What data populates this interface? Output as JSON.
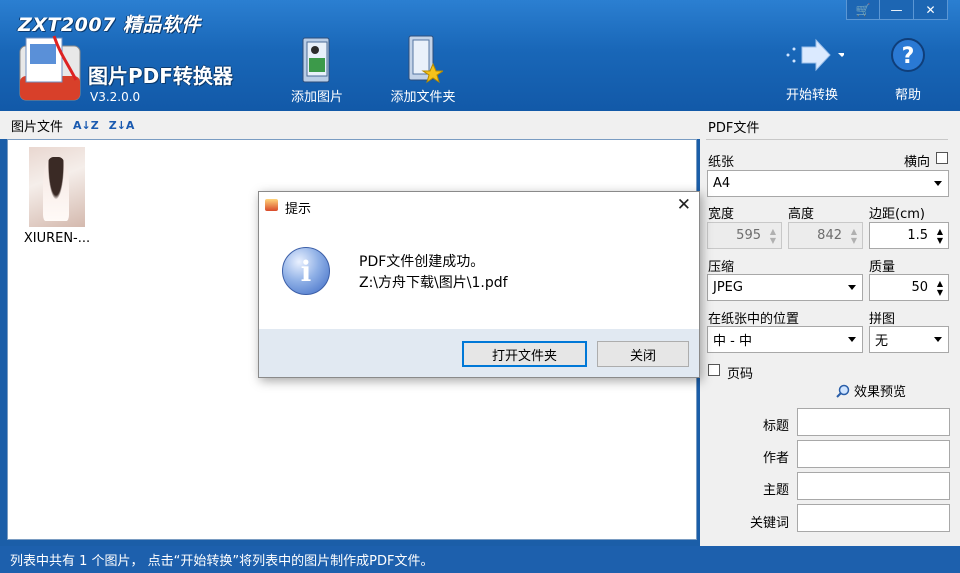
{
  "app": {
    "brand_top": "ZXT2007 精品软件",
    "name": "图片PDF转换器",
    "version": "V3.2.0.0"
  },
  "toolbar": {
    "add_image": "添加图片",
    "add_folder": "添加文件夹",
    "start": "开始转换",
    "help": "帮助"
  },
  "window_controls": {
    "cart": "🛒",
    "minimize": "—",
    "close": "✕"
  },
  "left": {
    "header_label": "图片文件",
    "sort_asc": "A↓Z",
    "sort_desc": "Z↓A",
    "files": [
      {
        "name": "XIUREN-..."
      }
    ]
  },
  "right": {
    "section_title": "PDF文件",
    "paper_label": "纸张",
    "landscape_label": "横向",
    "paper_value": "A4",
    "width_label": "宽度",
    "height_label": "高度",
    "margin_label": "边距(cm)",
    "width_value": "595",
    "height_value": "842",
    "margin_value": "1.5",
    "compress_label": "压缩",
    "quality_label": "质量",
    "compress_value": "JPEG",
    "quality_value": "50",
    "position_label": "在纸张中的位置",
    "tile_label": "拼图",
    "position_value": "中 - 中",
    "tile_value": "无",
    "page_number_label": "页码",
    "preview_label": "效果预览",
    "title_label": "标题",
    "author_label": "作者",
    "subject_label": "主题",
    "keywords_label": "关键词"
  },
  "dialog": {
    "title": "提示",
    "line1": "PDF文件创建成功。",
    "line2": "Z:\\方舟下载\\图片\\1.pdf",
    "open_folder": "打开文件夹",
    "close": "关闭"
  },
  "status": "列表中共有 1 个图片， 点击“开始转换”将列表中的图片制作成PDF文件。"
}
